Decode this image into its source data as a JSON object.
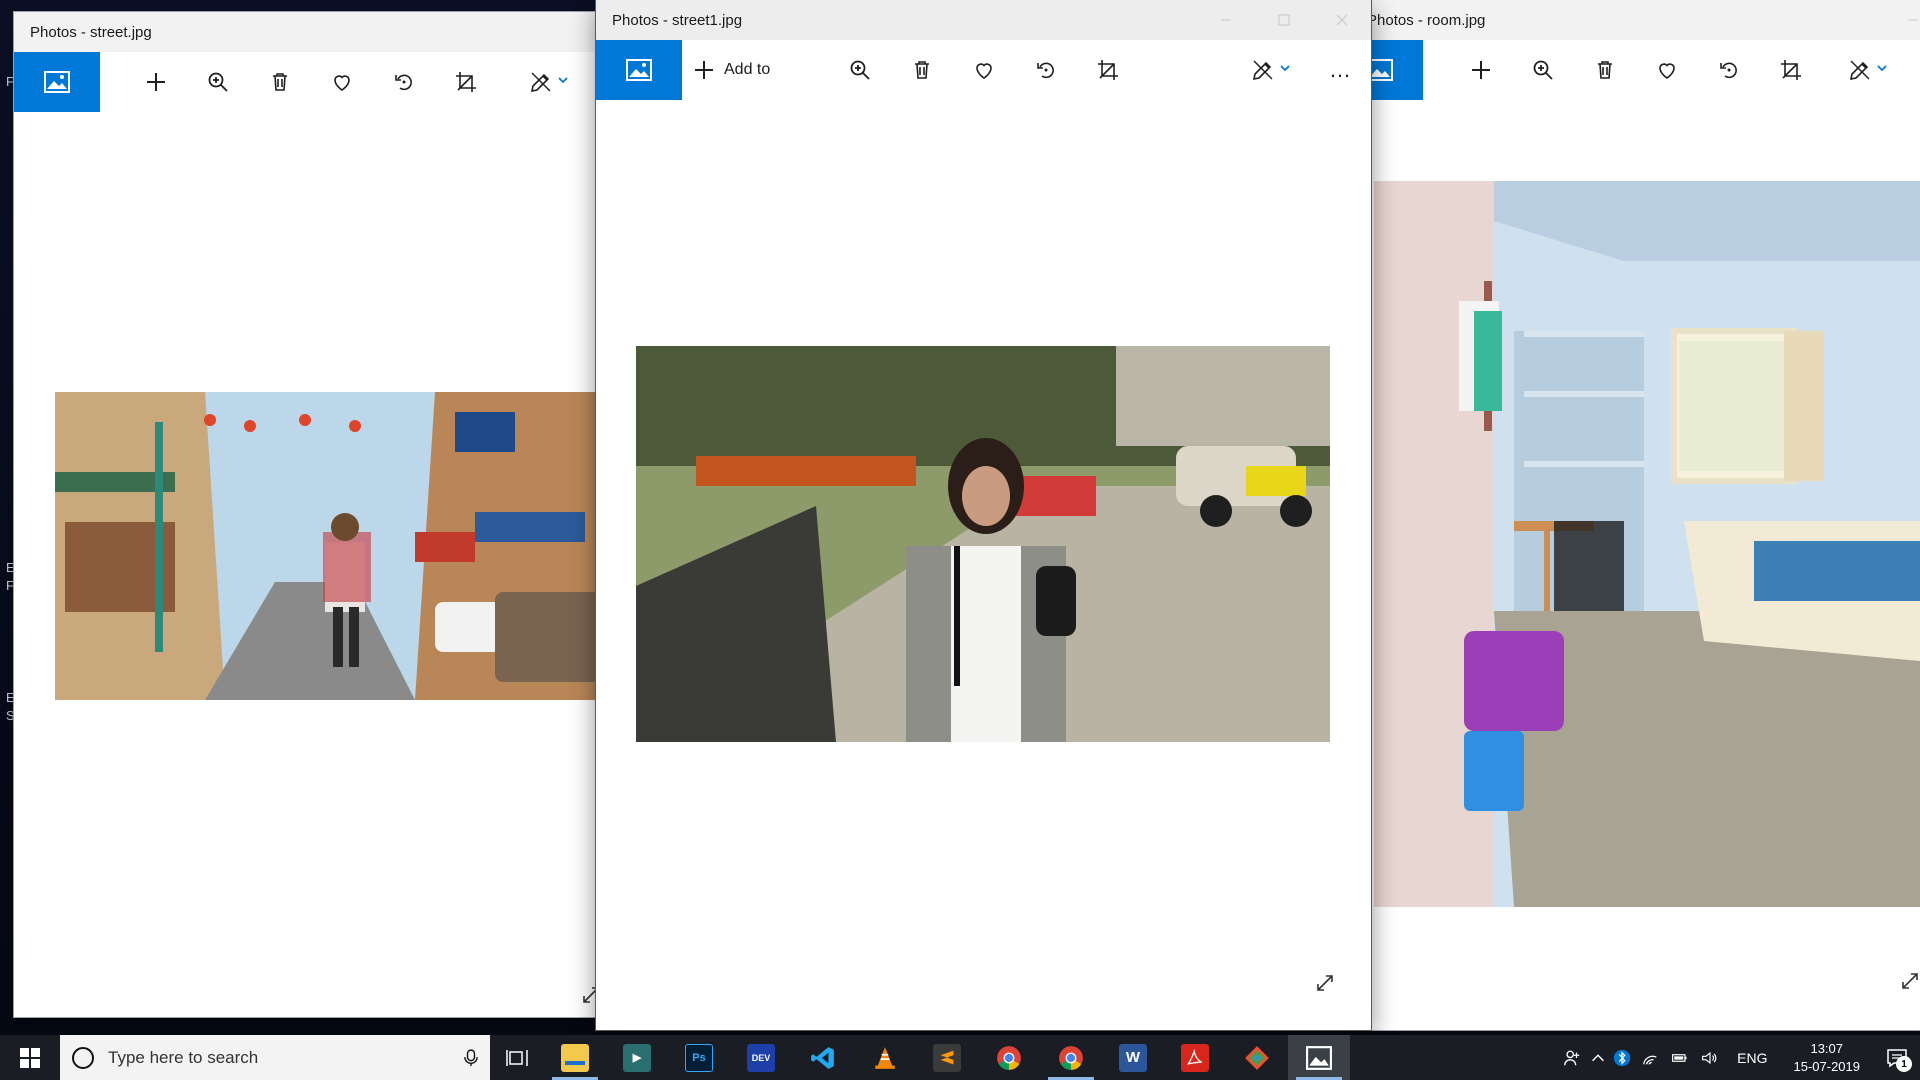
{
  "desktop": {
    "glyphs": [
      "F",
      "E",
      "F",
      "E",
      "S"
    ]
  },
  "windows": {
    "left": {
      "title": "Photos - street.jpg"
    },
    "middle": {
      "title": "Photos - street1.jpg",
      "add_to_label": "Add to",
      "more_label": "…"
    },
    "right": {
      "title": "Photos - room.jpg"
    }
  },
  "toolbar_icons": [
    "collection-icon",
    "add-icon",
    "zoom-in-icon",
    "delete-icon",
    "favorite-heart-icon",
    "rotate-icon",
    "crop-icon",
    "edit-draw-icon",
    "chevron-down-icon"
  ],
  "taskbar": {
    "search_placeholder": "Type here to search",
    "apps": [
      {
        "name": "file-explorer",
        "label": "",
        "color": "#f2c94c"
      },
      {
        "name": "app-launcher",
        "label": "",
        "color": "#2a6f6f"
      },
      {
        "name": "photoshop",
        "label": "Ps",
        "color": "#001e36"
      },
      {
        "name": "devc",
        "label": "DEV",
        "color": "#1f3fa8"
      },
      {
        "name": "vscode",
        "label": "",
        "color": "#0065a9"
      },
      {
        "name": "vlc",
        "label": "",
        "color": "#f28705"
      },
      {
        "name": "sublime-text",
        "label": "",
        "color": "#ff9800"
      },
      {
        "name": "chrome-1",
        "label": "",
        "color": "#4285f4"
      },
      {
        "name": "chrome-2",
        "label": "",
        "color": "#4285f4"
      },
      {
        "name": "word",
        "label": "W",
        "color": "#2b579a"
      },
      {
        "name": "acrobat",
        "label": "",
        "color": "#d8261c"
      },
      {
        "name": "git-gui",
        "label": "",
        "color": "#f14e32"
      },
      {
        "name": "photos",
        "label": "",
        "color": "#ffffff"
      }
    ],
    "tray": {
      "language": "ENG",
      "time": "13:07",
      "date": "15-07-2019",
      "notification_count": "1"
    }
  }
}
